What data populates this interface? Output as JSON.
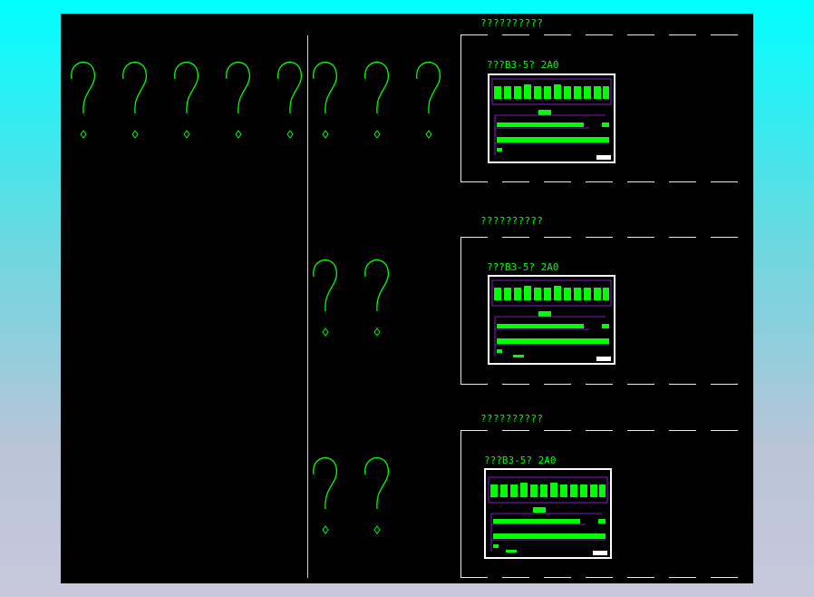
{
  "colors": {
    "background_top": "#00ffff",
    "background_bottom": "#c8c8dc",
    "canvas": "#000000",
    "glyph_green": "#00ff00",
    "frame_line": "#e8e8e8",
    "wire_magenta": "#aa22ff"
  },
  "canvas": {
    "question_glyph_icon": "missing-glyph-question-mark",
    "row_top_count": 8,
    "row_middle_count": 2,
    "row_bottom_count": 2
  },
  "panels": [
    {
      "caption": "??????????",
      "label": "???B3-5? 2A0"
    },
    {
      "caption": "??????????",
      "label": "???B3-5? 2A0"
    },
    {
      "caption": "??????????",
      "label": "???B3-5? 2A0"
    }
  ]
}
